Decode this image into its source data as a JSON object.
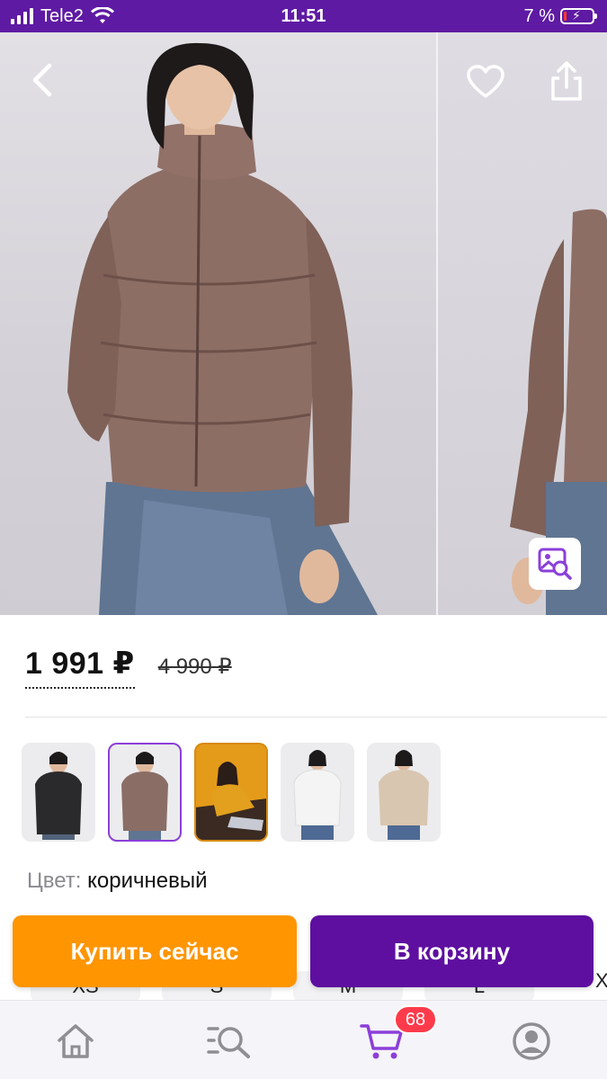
{
  "status_bar": {
    "carrier": "Tele2",
    "time": "11:51",
    "battery_text": "7 %",
    "battery_level": 0.07
  },
  "gallery": {
    "icons": [
      "back-chevron-icon",
      "heart-icon",
      "share-icon",
      "image-search-icon"
    ]
  },
  "product": {
    "price": "1 991 ₽",
    "old_price": "4 990 ₽",
    "color_label": "Цвет:",
    "color_value": "коричневый",
    "swatches": [
      {
        "color": "#2a2a2c",
        "selected": false
      },
      {
        "color": "#8a6e66",
        "selected": true
      },
      {
        "color": "#e2a01e",
        "selected": false
      },
      {
        "color": "#f4f4f4",
        "selected": false
      },
      {
        "color": "#d9c6b0",
        "selected": false
      }
    ]
  },
  "sizes": {
    "chips": [
      "XS",
      "S",
      "M",
      "L"
    ],
    "overflow": "X"
  },
  "actions": {
    "buy_now": "Купить сейчас",
    "add_to_cart": "В корзину"
  },
  "tabbar": {
    "tabs": [
      {
        "icon": "home-icon"
      },
      {
        "icon": "catalog-search-icon"
      },
      {
        "icon": "cart-icon",
        "active": true
      },
      {
        "icon": "profile-icon"
      }
    ],
    "cart_badge": "68"
  },
  "colors": {
    "brand_purple": "#5e0fa0",
    "accent_orange": "#ff9500",
    "status_bar": "#5e1aa3",
    "badge_red": "#ff3b4b"
  }
}
